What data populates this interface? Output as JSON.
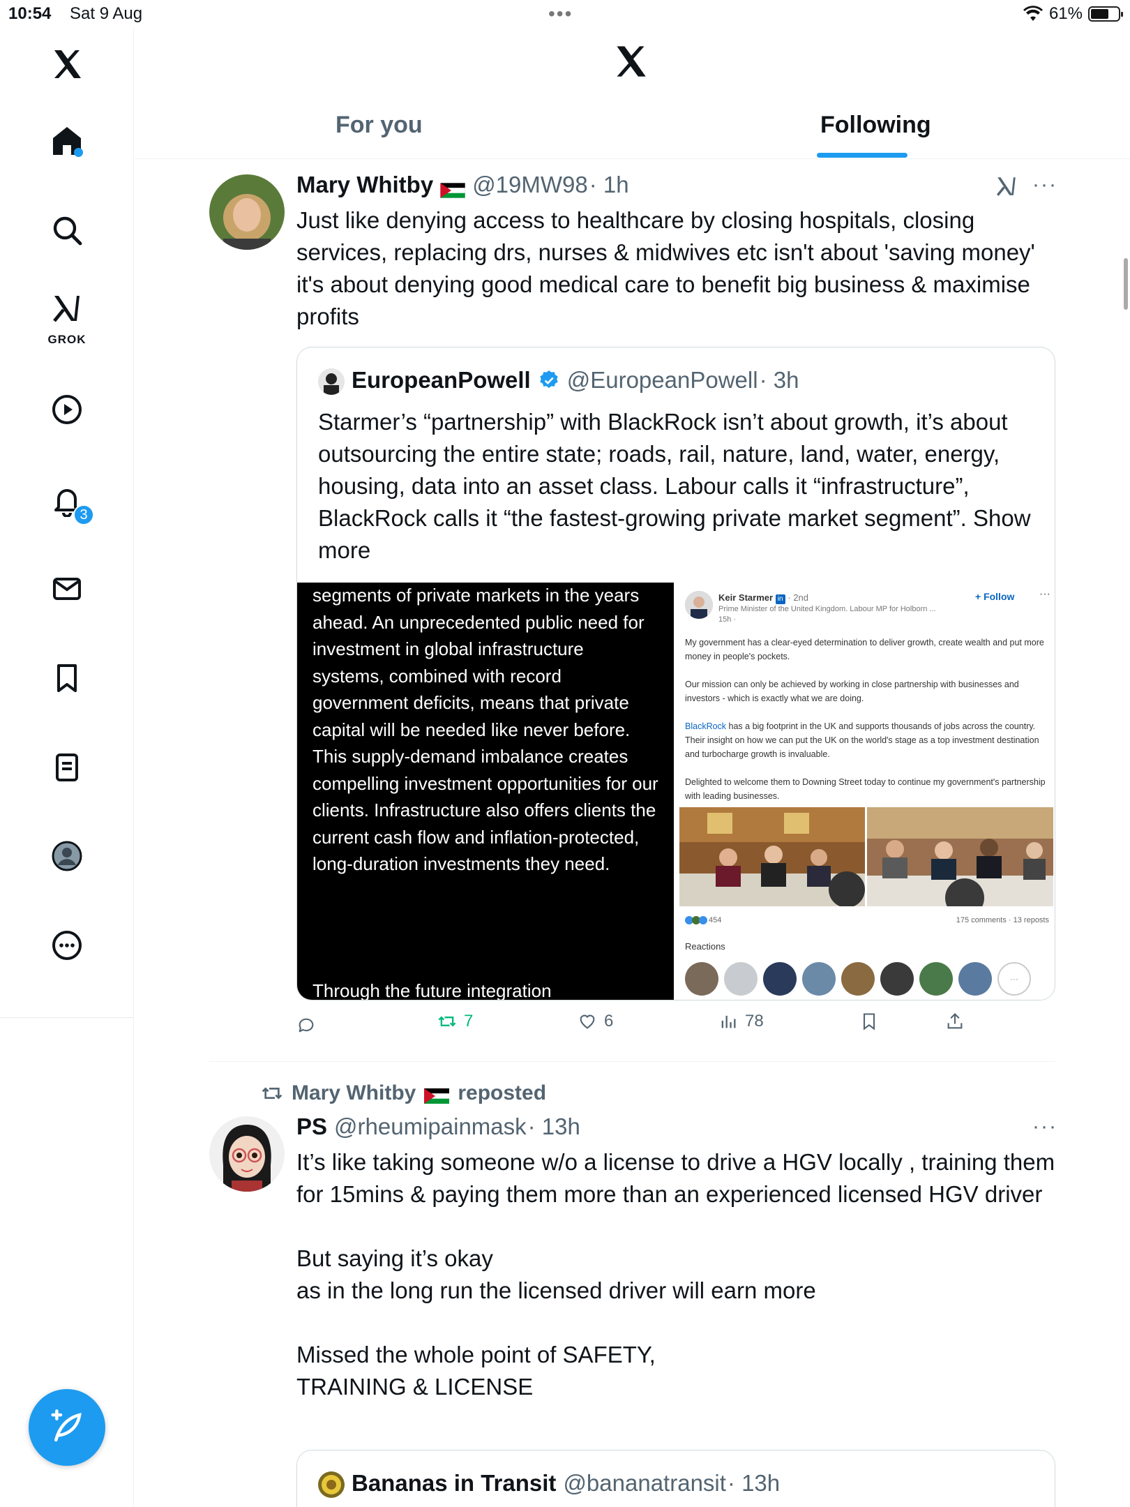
{
  "status": {
    "time": "10:54",
    "date": "Sat 9 Aug",
    "battery": "61%"
  },
  "sidebar": {
    "grok_label": "GROK",
    "notifications_badge": "3"
  },
  "header": {
    "tabs": [
      {
        "label": "For you"
      },
      {
        "label": "Following"
      }
    ]
  },
  "tweet1": {
    "name": "Mary Whitby",
    "handle": "@19MW98",
    "time": "· 1h",
    "text": "Just like denying access to healthcare by closing hospitals, closing services, replacing drs, nurses & midwives etc isn't about 'saving money' it's about denying good medical care to benefit big business & maximise profits",
    "quote": {
      "name": "EuropeanPowell",
      "handle": "@EuropeanPowell",
      "time": "· 3h",
      "text": "Starmer’s “partnership” with BlackRock isn’t about growth, it’s about outsourcing the entire state; roads, rail, nature, land, water, energy, housing, data into an asset class. Labour calls it “infrastructure”, BlackRock calls it “the fastest-growing private market segment”.",
      "show_more": "Show more",
      "media_left_text": "segments of private markets in the years ahead. An unprecedented public need for investment in global infrastructure systems, combined with record government deficits, means that private capital will be needed like never before. This supply-demand imbalance creates compelling investment opportunities for our clients. Infrastructure also offers clients the current cash flow and inflation-protected, long-duration investments they need.",
      "media_left_tail": "Through the future integration",
      "media_right": {
        "author": "Keir Starmer",
        "degree": "· 2nd",
        "subtitle": "Prime Minister of the United Kingdom. Labour MP for Holborn ...",
        "age": "15h ·",
        "follow": "+ Follow",
        "p1": "My government has a clear-eyed determination to deliver growth, create wealth and put more money in people's pockets.",
        "p2": "Our mission can only be achieved by working in close partnership with businesses and investors - which is exactly what we are doing.",
        "p3_link": "BlackRock",
        "p3": " has a big footprint in the UK and supports thousands of jobs across the country. Their insight on how we can put the UK on the world's stage as a top investment destination and turbocharge growth is invaluable.",
        "p4": "Delighted to welcome them to Downing Street today to continue my government's partnership with leading businesses.",
        "reactions_count": "454",
        "comments": "175 comments · 13 reposts",
        "reactions_label": "Reactions"
      }
    },
    "actions": {
      "replies": "",
      "reposts": "7",
      "likes": "6",
      "views": "78"
    }
  },
  "tweet2": {
    "repost_by": "Mary Whitby",
    "reposted": "reposted",
    "name": "PS",
    "handle": "@rheumipainmask",
    "time": "· 13h",
    "lines": [
      "It’s like taking someone w/o a license to drive a HGV locally , training them for 15mins & paying them more than an experienced licensed HGV driver",
      "",
      "But saying it’s okay",
      "as in the long run the licensed driver will earn more",
      "",
      "Missed the whole point of SAFETY,",
      "TRAINING & LICENSE"
    ],
    "quote": {
      "name": "Bananas in Transit",
      "handle": "@bananatransit",
      "time": "· 13h"
    }
  },
  "colors": {
    "accent": "#1d9bf0",
    "repost_green": "#00ba7c",
    "muted": "#536471"
  }
}
